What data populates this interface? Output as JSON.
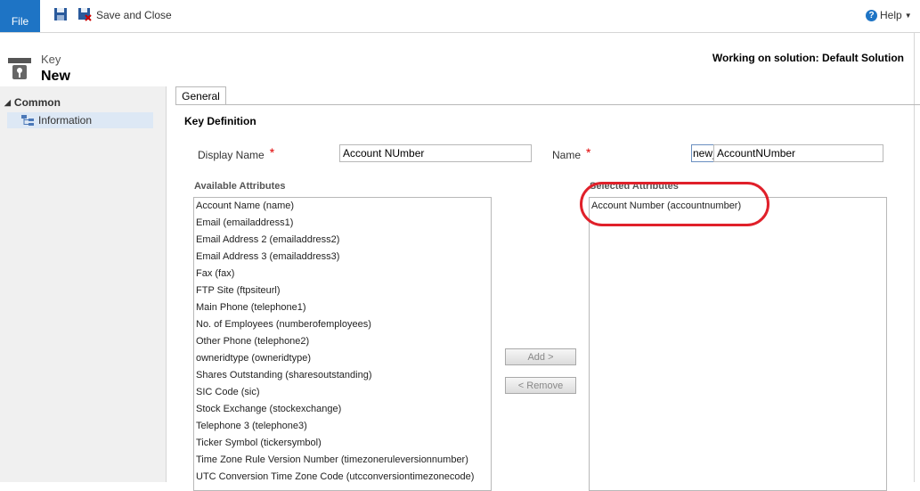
{
  "ribbon": {
    "file_label": "File",
    "save_close_label": "Save and Close",
    "help_label": "Help"
  },
  "header": {
    "entity_label": "Key",
    "record_title": "New",
    "solution_text": "Working on solution: Default Solution"
  },
  "nav": {
    "group_label": "Common",
    "items": [
      {
        "label": "Information"
      }
    ]
  },
  "tabs": [
    {
      "label": "General"
    }
  ],
  "form": {
    "section_title": "Key Definition",
    "display_name_label": "Display Name",
    "display_name_value": "Account NUmber",
    "name_label": "Name",
    "name_prefix": "new_",
    "name_value": "AccountNUmber",
    "available_label": "Available Attributes",
    "selected_label": "Selected Attributes",
    "available_attributes": [
      "Account Name (name)",
      "Email (emailaddress1)",
      "Email Address 2 (emailaddress2)",
      "Email Address 3 (emailaddress3)",
      "Fax (fax)",
      "FTP Site (ftpsiteurl)",
      "Main Phone (telephone1)",
      "No. of Employees (numberofemployees)",
      "Other Phone (telephone2)",
      "owneridtype (owneridtype)",
      "Shares Outstanding (sharesoutstanding)",
      "SIC Code (sic)",
      "Stock Exchange (stockexchange)",
      "Telephone 3 (telephone3)",
      "Ticker Symbol (tickersymbol)",
      "Time Zone Rule Version Number (timezoneruleversionnumber)",
      "UTC Conversion Time Zone Code (utcconversiontimezonecode)"
    ],
    "selected_attributes": [
      "Account Number (accountnumber)"
    ],
    "add_label": "Add >",
    "remove_label": "< Remove"
  },
  "colors": {
    "file_blue": "#1e74c5",
    "highlight_red": "#e0202a",
    "required_red": "#e00000"
  }
}
